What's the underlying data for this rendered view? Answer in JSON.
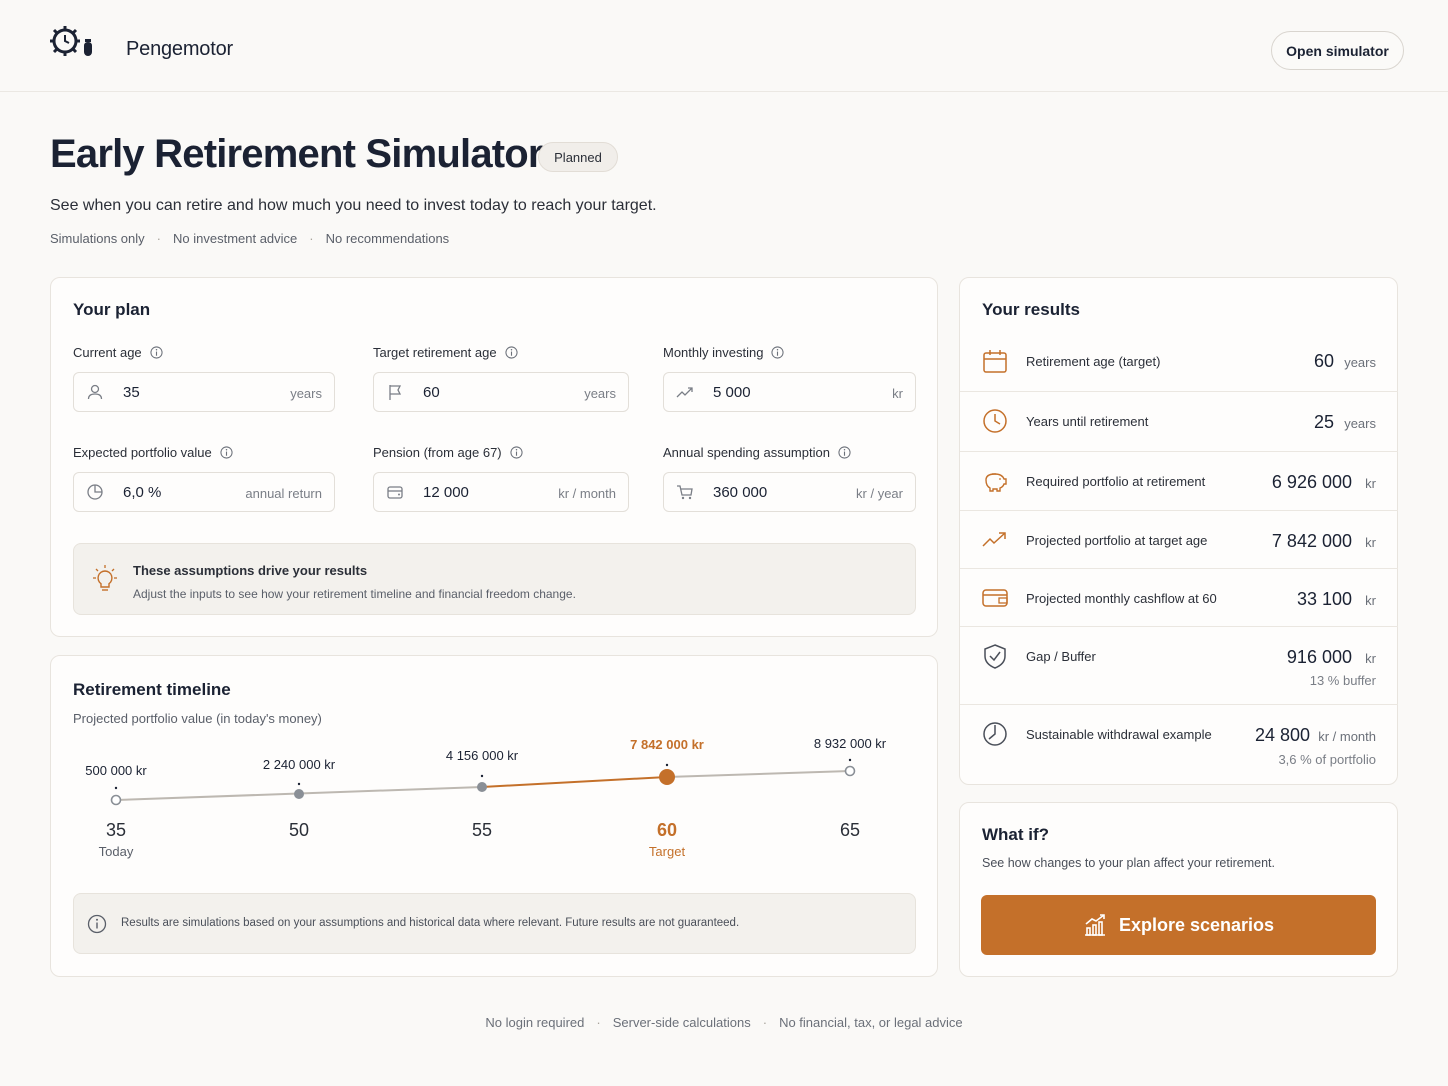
{
  "header": {
    "brand": "Pengemotor",
    "open_simulator": "Open simulator"
  },
  "page": {
    "title": "Early Retirement Simulator",
    "badge": "Planned",
    "subtitle": "See when you can retire and how much you need to invest today to reach your target.",
    "disclaimers": [
      "Simulations only",
      "No investment advice",
      "No recommendations"
    ]
  },
  "plan": {
    "title": "Your plan",
    "fields": [
      {
        "label": "Current age",
        "value": "35",
        "unit": "years",
        "icon": "person-icon"
      },
      {
        "label": "Target retirement age",
        "value": "60",
        "unit": "years",
        "icon": "flag-icon"
      },
      {
        "label": "Monthly investing",
        "value": "5 000",
        "unit": "kr",
        "icon": "trend-up-icon"
      },
      {
        "label": "Expected portfolio value",
        "value": "6,0 %",
        "unit": "annual return",
        "icon": "pie-icon"
      },
      {
        "label": "Pension (from age 67)",
        "value": "12 000",
        "unit": "kr / month",
        "icon": "wallet-icon"
      },
      {
        "label": "Annual spending assumption",
        "value": "360 000",
        "unit": "kr / year",
        "icon": "cart-icon"
      }
    ],
    "note_title": "These assumptions drive your results",
    "note_text": "Adjust the inputs to see how your retirement timeline and financial freedom change."
  },
  "timeline": {
    "title": "Retirement timeline",
    "subtitle": "Projected portfolio value (in today's money)",
    "points": [
      {
        "age": "35",
        "value": "500 000 kr",
        "caption": "Today"
      },
      {
        "age": "50",
        "value": "2 240 000 kr",
        "caption": ""
      },
      {
        "age": "55",
        "value": "4 156 000 kr",
        "caption": ""
      },
      {
        "age": "60",
        "value": "7 842 000 kr",
        "caption": "Target"
      },
      {
        "age": "65",
        "value": "8 932 000 kr",
        "caption": ""
      }
    ],
    "disclaimer": "Results are simulations based on your assumptions and historical data where relevant. Future results are not guaranteed.",
    "accent": "#c4702a"
  },
  "results": {
    "title": "Your results",
    "rows": [
      {
        "label": "Retirement age (target)",
        "value": "60",
        "unit": "years",
        "sub": "",
        "icon": "calendar-icon"
      },
      {
        "label": "Years until retirement",
        "value": "25",
        "unit": "years",
        "sub": "",
        "icon": "clock-icon"
      },
      {
        "label": "Required portfolio at retirement",
        "value": "6 926 000",
        "unit": "kr",
        "sub": "",
        "icon": "piggy-bank-icon"
      },
      {
        "label": "Projected portfolio at target age",
        "value": "7 842 000",
        "unit": "kr",
        "sub": "",
        "icon": "trend-up-icon"
      },
      {
        "label": "Projected monthly cashflow at 60",
        "value": "33 100",
        "unit": "kr",
        "sub": "",
        "icon": "wallet-icon"
      },
      {
        "label": "Gap / Buffer",
        "value": "916 000",
        "unit": "kr",
        "sub": "13 % buffer",
        "icon": "shield-icon"
      },
      {
        "label": "Sustainable withdrawal example",
        "value": "24 800",
        "unit": "kr / month",
        "sub": "3,6 % of portfolio",
        "icon": "clock-half-icon"
      }
    ]
  },
  "whatif": {
    "title": "What if?",
    "text": "See how changes to your plan affect your retirement.",
    "button": "Explore scenarios"
  },
  "footer": [
    "No login required",
    "Server-side calculations",
    "No financial, tax, or legal advice"
  ]
}
